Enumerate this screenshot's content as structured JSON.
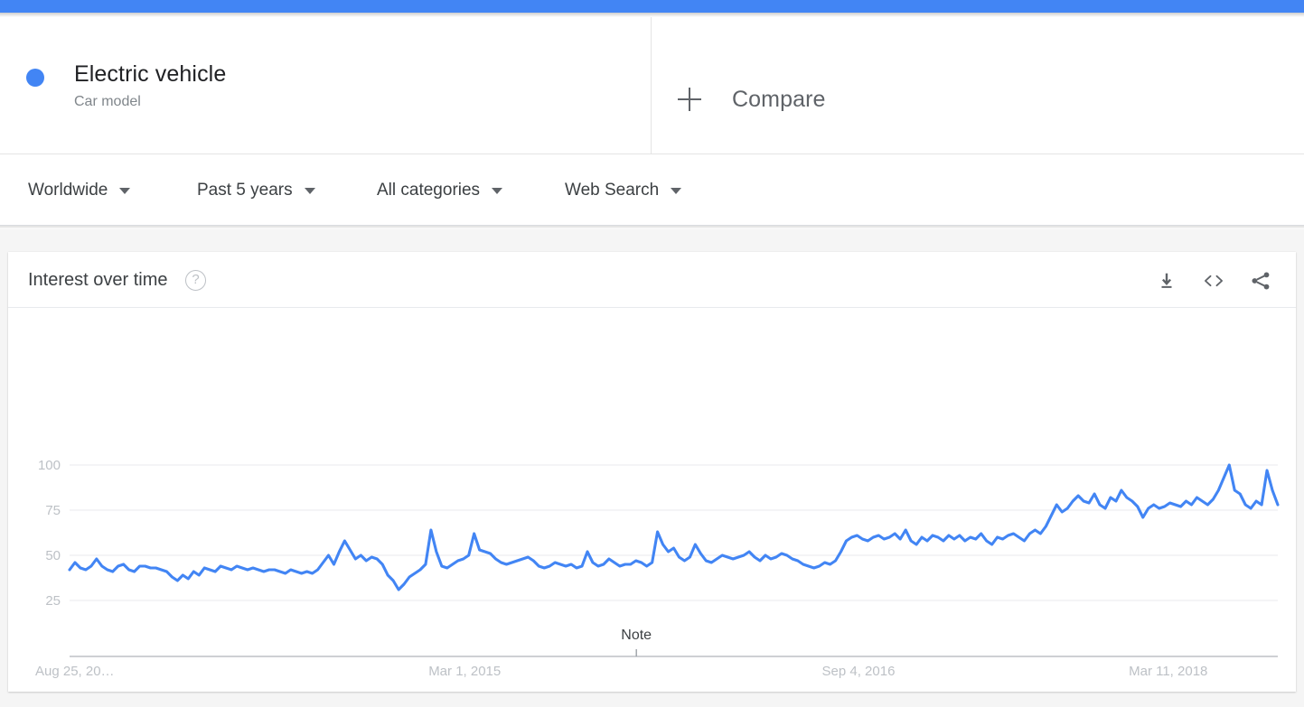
{
  "topbar": {
    "color": "#4285f4"
  },
  "terms": {
    "search_term": {
      "label": "Electric vehicle",
      "subtitle": "Car model",
      "color": "#4285f4"
    },
    "compare": {
      "label": "Compare",
      "icon": "plus-icon"
    }
  },
  "filters": [
    {
      "label": "Worldwide"
    },
    {
      "label": "Past 5 years"
    },
    {
      "label": "All categories"
    },
    {
      "label": "Web Search"
    }
  ],
  "chart_panel": {
    "title": "Interest over time",
    "help_icon": "?",
    "actions": [
      {
        "name": "download-icon"
      },
      {
        "name": "embed-icon"
      },
      {
        "name": "share-icon"
      }
    ]
  },
  "chart_data": {
    "type": "line",
    "title": "Interest over time",
    "xlabel": "",
    "ylabel": "",
    "ylim": [
      0,
      100
    ],
    "yticks": [
      100,
      75,
      50,
      25
    ],
    "grid": true,
    "legend_position": "top",
    "xtick_labels": [
      "Aug 25, 20…",
      "Mar 1, 2015",
      "Sep 4, 2016",
      "Mar 11, 2018"
    ],
    "xtick_positions": [
      0,
      0.3255,
      0.6511,
      0.9051
    ],
    "annotations": [
      {
        "text": "Note",
        "x_fraction": 0.4691
      }
    ],
    "series": [
      {
        "name": "Electric vehicle",
        "color": "#4285f4",
        "values": [
          42,
          46,
          43,
          42,
          44,
          48,
          44,
          42,
          41,
          44,
          45,
          42,
          41,
          44,
          44,
          43,
          43,
          42,
          41,
          38,
          36,
          39,
          37,
          41,
          39,
          43,
          42,
          41,
          44,
          43,
          42,
          44,
          43,
          42,
          43,
          42,
          41,
          42,
          42,
          41,
          40,
          42,
          41,
          40,
          41,
          40,
          42,
          46,
          50,
          45,
          52,
          58,
          53,
          48,
          50,
          47,
          49,
          48,
          45,
          39,
          36,
          31,
          34,
          38,
          40,
          42,
          45,
          64,
          52,
          44,
          43,
          45,
          47,
          48,
          50,
          62,
          53,
          52,
          51,
          48,
          46,
          45,
          46,
          47,
          48,
          49,
          47,
          44,
          43,
          44,
          46,
          45,
          44,
          45,
          43,
          44,
          52,
          46,
          44,
          45,
          48,
          46,
          44,
          45,
          45,
          47,
          46,
          44,
          46,
          63,
          56,
          52,
          54,
          49,
          47,
          49,
          56,
          51,
          47,
          46,
          48,
          50,
          49,
          48,
          49,
          50,
          52,
          49,
          47,
          50,
          48,
          49,
          51,
          50,
          48,
          47,
          45,
          44,
          43,
          44,
          46,
          45,
          47,
          52,
          58,
          60,
          61,
          59,
          58,
          60,
          61,
          59,
          60,
          62,
          59,
          64,
          58,
          56,
          60,
          58,
          61,
          60,
          58,
          61,
          59,
          61,
          58,
          60,
          59,
          62,
          58,
          56,
          60,
          59,
          61,
          62,
          60,
          58,
          62,
          64,
          62,
          66,
          72,
          78,
          74,
          76,
          80,
          83,
          80,
          79,
          84,
          78,
          76,
          82,
          80,
          86,
          82,
          80,
          77,
          71,
          76,
          78,
          76,
          77,
          79,
          78,
          77,
          80,
          78,
          82,
          80,
          78,
          81,
          86,
          93,
          100,
          86,
          84,
          78,
          76,
          80,
          78,
          97,
          86,
          78
        ]
      }
    ]
  }
}
